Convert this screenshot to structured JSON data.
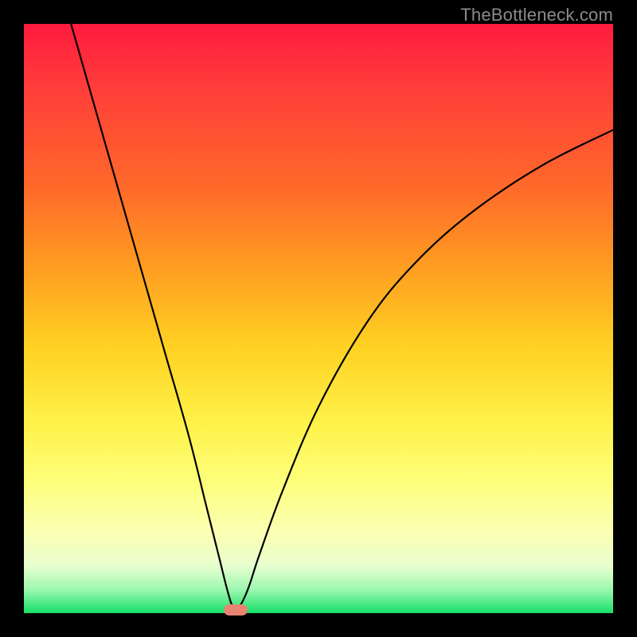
{
  "watermark": {
    "text": "TheBottleneck.com"
  },
  "chart_data": {
    "type": "line",
    "title": "",
    "xlabel": "",
    "ylabel": "",
    "xlim": [
      0,
      100
    ],
    "ylim": [
      0,
      100
    ],
    "grid": false,
    "legend": false,
    "series": [
      {
        "name": "curve",
        "x": [
          8,
          12,
          16,
          20,
          24,
          28,
          31,
          33,
          34.5,
          35.5,
          36.5,
          38,
          40,
          44,
          50,
          58,
          66,
          76,
          88,
          100
        ],
        "y": [
          100,
          86,
          72,
          58,
          44,
          30,
          18,
          10,
          4,
          1,
          1,
          4,
          10,
          21,
          35,
          49,
          59,
          68,
          76,
          82
        ]
      }
    ],
    "vertex": {
      "x": 36,
      "y": 0.5
    },
    "background_gradient": {
      "orientation": "vertical",
      "stops": [
        {
          "pos": 0.0,
          "color": "#ff1a3e"
        },
        {
          "pos": 0.55,
          "color": "#ffd223"
        },
        {
          "pos": 0.86,
          "color": "#fbffb2"
        },
        {
          "pos": 1.0,
          "color": "#16e06a"
        }
      ]
    },
    "marker": {
      "color": "#e98472",
      "shape": "rounded-rect"
    }
  }
}
